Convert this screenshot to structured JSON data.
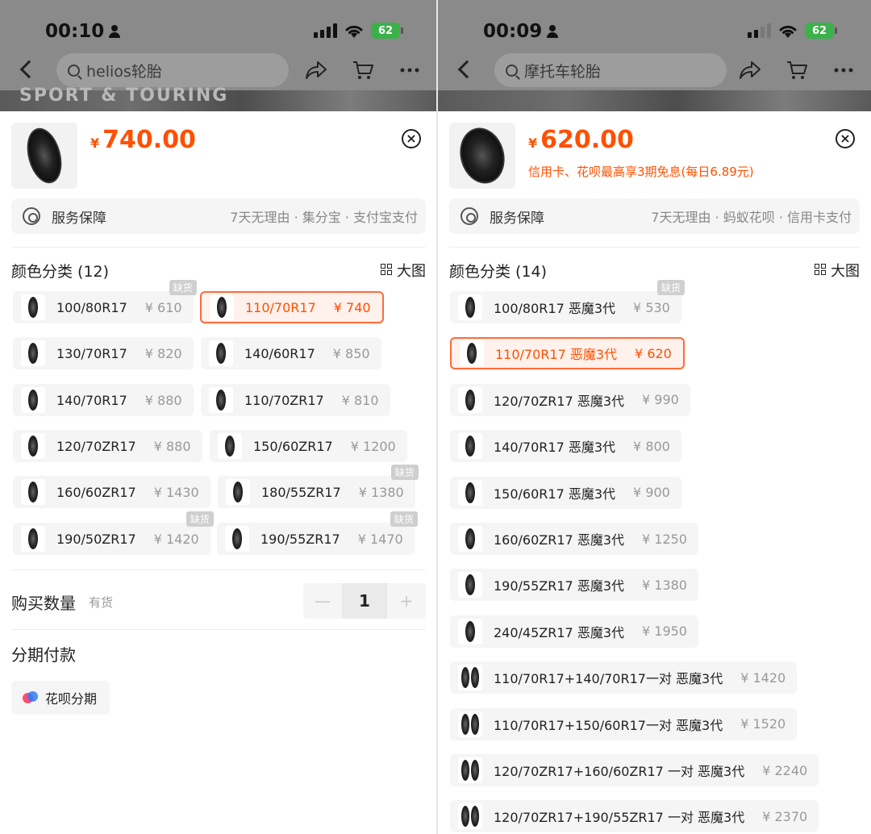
{
  "left": {
    "status_time": "00:10",
    "battery": "62",
    "search_query": "helios轮胎",
    "hero_text": "SPORT & TOURING",
    "price_symbol": "¥",
    "price": "740.00",
    "service_label": "服务保障",
    "service_detail": "7天无理由 · 集分宝 · 支付宝支付",
    "section_title": "颜色分类 (12)",
    "big_image_label": "大图",
    "oos_label": "缺货",
    "options": [
      {
        "label": "100/80R17",
        "price": "¥ 610",
        "oos": true,
        "selected": false
      },
      {
        "label": "110/70R17",
        "price": "¥ 740",
        "oos": false,
        "selected": true
      },
      {
        "label": "130/70R17",
        "price": "¥ 820",
        "oos": false,
        "selected": false
      },
      {
        "label": "140/60R17",
        "price": "¥ 850",
        "oos": false,
        "selected": false
      },
      {
        "label": "140/70R17",
        "price": "¥ 880",
        "oos": false,
        "selected": false
      },
      {
        "label": "110/70ZR17",
        "price": "¥ 810",
        "oos": false,
        "selected": false
      },
      {
        "label": "120/70ZR17",
        "price": "¥ 880",
        "oos": false,
        "selected": false
      },
      {
        "label": "150/60ZR17",
        "price": "¥ 1200",
        "oos": false,
        "selected": false
      },
      {
        "label": "160/60ZR17",
        "price": "¥ 1430",
        "oos": false,
        "selected": false
      },
      {
        "label": "180/55ZR17",
        "price": "¥ 1380",
        "oos": true,
        "selected": false
      },
      {
        "label": "190/50ZR17",
        "price": "¥ 1420",
        "oos": true,
        "selected": false
      },
      {
        "label": "190/55ZR17",
        "price": "¥ 1470",
        "oos": true,
        "selected": false
      }
    ],
    "quantity_label": "购买数量",
    "stock_label": "有货",
    "quantity": "1",
    "minus": "—",
    "plus": "+",
    "installment_title": "分期付款",
    "installment_option": "花呗分期"
  },
  "right": {
    "status_time": "00:09",
    "battery": "62",
    "search_query": "摩托车轮胎",
    "price_symbol": "¥",
    "price": "620.00",
    "promo": "信用卡、花呗最高享3期免息(每日6.89元)",
    "service_label": "服务保障",
    "service_detail": "7天无理由 · 蚂蚁花呗 · 信用卡支付",
    "section_title": "颜色分类 (14)",
    "big_image_label": "大图",
    "oos_label": "缺货",
    "options": [
      {
        "label": "100/80R17 恶魔3代",
        "price": "¥ 530",
        "oos": true,
        "selected": false,
        "pair": false
      },
      {
        "label": "110/70R17 恶魔3代",
        "price": "¥ 620",
        "oos": false,
        "selected": true,
        "pair": false
      },
      {
        "label": "120/70ZR17 恶魔3代",
        "price": "¥ 990",
        "oos": false,
        "selected": false,
        "pair": false
      },
      {
        "label": "140/70R17 恶魔3代",
        "price": "¥ 800",
        "oos": false,
        "selected": false,
        "pair": false
      },
      {
        "label": "150/60R17 恶魔3代",
        "price": "¥ 900",
        "oos": false,
        "selected": false,
        "pair": false
      },
      {
        "label": "160/60ZR17 恶魔3代",
        "price": "¥ 1250",
        "oos": false,
        "selected": false,
        "pair": false
      },
      {
        "label": "190/55ZR17 恶魔3代",
        "price": "¥ 1380",
        "oos": false,
        "selected": false,
        "pair": false
      },
      {
        "label": "240/45ZR17 恶魔3代",
        "price": "¥ 1950",
        "oos": false,
        "selected": false,
        "pair": false
      },
      {
        "label": "110/70R17+140/70R17一对 恶魔3代",
        "price": "¥ 1420",
        "oos": false,
        "selected": false,
        "pair": true
      },
      {
        "label": "110/70R17+150/60R17一对 恶魔3代",
        "price": "¥ 1520",
        "oos": false,
        "selected": false,
        "pair": true
      },
      {
        "label": "120/70ZR17+160/60ZR17 一对 恶魔3代",
        "price": "¥ 2240",
        "oos": false,
        "selected": false,
        "pair": true
      },
      {
        "label": "120/70ZR17+190/55ZR17 一对 恶魔3代",
        "price": "¥ 2370",
        "oos": false,
        "selected": false,
        "pair": true
      }
    ]
  },
  "colors": {
    "accent": "#ff5000",
    "selected_border": "#ff6a3a",
    "option_bg": "#f5f5f5",
    "battery": "#3bb14a"
  }
}
